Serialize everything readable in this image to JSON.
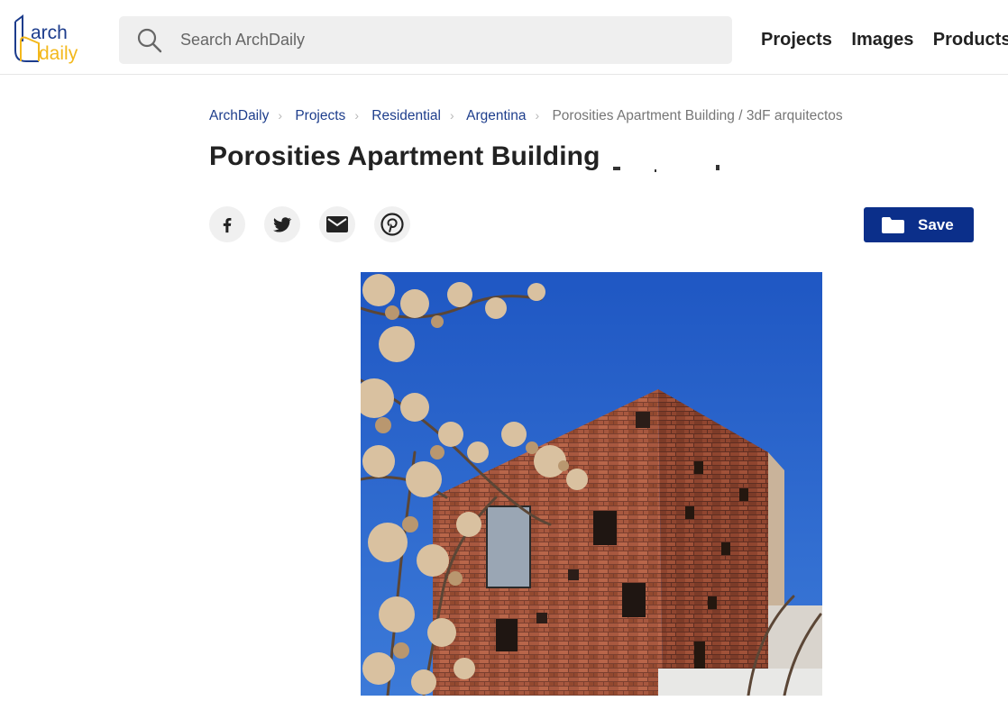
{
  "header": {
    "logo": {
      "line1": "arch",
      "line2": "daily",
      "colors": {
        "top": "#1c3c8c",
        "bottom": "#f3b81c"
      }
    },
    "search": {
      "placeholder": "Search ArchDaily",
      "value": ""
    },
    "nav": [
      {
        "label": "Projects"
      },
      {
        "label": "Images"
      },
      {
        "label": "Products &"
      }
    ]
  },
  "breadcrumb": {
    "items": [
      {
        "label": "ArchDaily"
      },
      {
        "label": "Projects"
      },
      {
        "label": "Residential"
      },
      {
        "label": "Argentina"
      }
    ],
    "current": "Porosities Apartment Building / 3dF arquitectos"
  },
  "page": {
    "title": "Porosities Apartment Building"
  },
  "share": [
    {
      "icon": "facebook-icon"
    },
    {
      "icon": "twitter-icon"
    },
    {
      "icon": "email-icon"
    },
    {
      "icon": "pinterest-icon"
    }
  ],
  "actions": {
    "save_label": "Save",
    "accent": "#0b2f8a"
  },
  "photo": {
    "subject": "brick-apartment-building"
  }
}
